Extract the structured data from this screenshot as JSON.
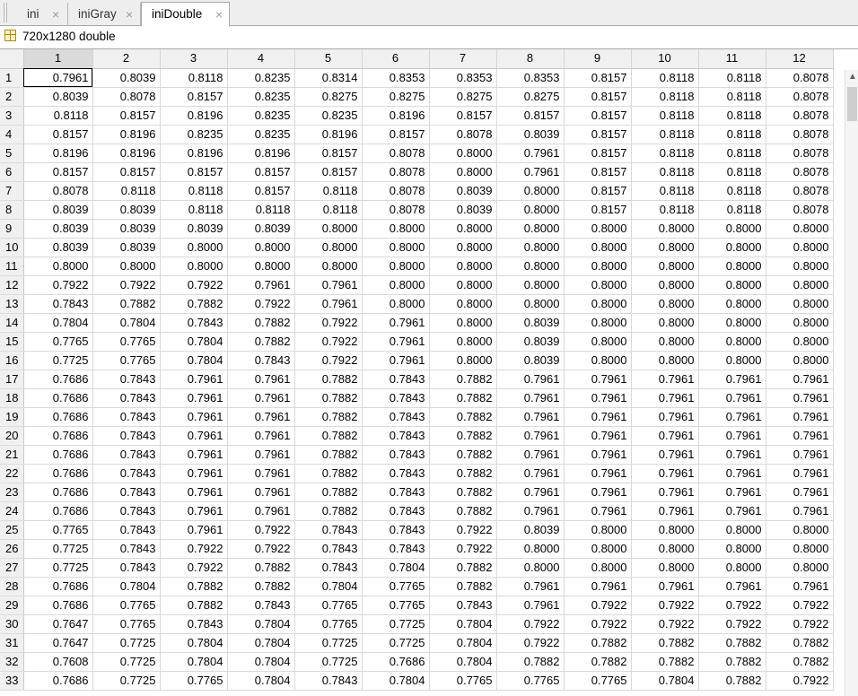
{
  "tabs": [
    {
      "label": "ini",
      "active": false
    },
    {
      "label": "iniGray",
      "active": false
    },
    {
      "label": "iniDouble",
      "active": true
    }
  ],
  "tab_close_glyph": "×",
  "variable_info": "720x1280 double",
  "columns": [
    "1",
    "2",
    "3",
    "4",
    "5",
    "6",
    "7",
    "8",
    "9",
    "10",
    "11",
    "12"
  ],
  "rows": [
    {
      "n": "1",
      "v": [
        "0.7961",
        "0.8039",
        "0.8118",
        "0.8235",
        "0.8314",
        "0.8353",
        "0.8353",
        "0.8353",
        "0.8157",
        "0.8118",
        "0.8118",
        "0.8078"
      ]
    },
    {
      "n": "2",
      "v": [
        "0.8039",
        "0.8078",
        "0.8157",
        "0.8235",
        "0.8275",
        "0.8275",
        "0.8275",
        "0.8275",
        "0.8157",
        "0.8118",
        "0.8118",
        "0.8078"
      ]
    },
    {
      "n": "3",
      "v": [
        "0.8118",
        "0.8157",
        "0.8196",
        "0.8235",
        "0.8235",
        "0.8196",
        "0.8157",
        "0.8157",
        "0.8157",
        "0.8118",
        "0.8118",
        "0.8078"
      ]
    },
    {
      "n": "4",
      "v": [
        "0.8157",
        "0.8196",
        "0.8235",
        "0.8235",
        "0.8196",
        "0.8157",
        "0.8078",
        "0.8039",
        "0.8157",
        "0.8118",
        "0.8118",
        "0.8078"
      ]
    },
    {
      "n": "5",
      "v": [
        "0.8196",
        "0.8196",
        "0.8196",
        "0.8196",
        "0.8157",
        "0.8078",
        "0.8000",
        "0.7961",
        "0.8157",
        "0.8118",
        "0.8118",
        "0.8078"
      ]
    },
    {
      "n": "6",
      "v": [
        "0.8157",
        "0.8157",
        "0.8157",
        "0.8157",
        "0.8157",
        "0.8078",
        "0.8000",
        "0.7961",
        "0.8157",
        "0.8118",
        "0.8118",
        "0.8078"
      ]
    },
    {
      "n": "7",
      "v": [
        "0.8078",
        "0.8118",
        "0.8118",
        "0.8157",
        "0.8118",
        "0.8078",
        "0.8039",
        "0.8000",
        "0.8157",
        "0.8118",
        "0.8118",
        "0.8078"
      ]
    },
    {
      "n": "8",
      "v": [
        "0.8039",
        "0.8039",
        "0.8118",
        "0.8118",
        "0.8118",
        "0.8078",
        "0.8039",
        "0.8000",
        "0.8157",
        "0.8118",
        "0.8118",
        "0.8078"
      ]
    },
    {
      "n": "9",
      "v": [
        "0.8039",
        "0.8039",
        "0.8039",
        "0.8039",
        "0.8000",
        "0.8000",
        "0.8000",
        "0.8000",
        "0.8000",
        "0.8000",
        "0.8000",
        "0.8000"
      ]
    },
    {
      "n": "10",
      "v": [
        "0.8039",
        "0.8039",
        "0.8000",
        "0.8000",
        "0.8000",
        "0.8000",
        "0.8000",
        "0.8000",
        "0.8000",
        "0.8000",
        "0.8000",
        "0.8000"
      ]
    },
    {
      "n": "11",
      "v": [
        "0.8000",
        "0.8000",
        "0.8000",
        "0.8000",
        "0.8000",
        "0.8000",
        "0.8000",
        "0.8000",
        "0.8000",
        "0.8000",
        "0.8000",
        "0.8000"
      ]
    },
    {
      "n": "12",
      "v": [
        "0.7922",
        "0.7922",
        "0.7922",
        "0.7961",
        "0.7961",
        "0.8000",
        "0.8000",
        "0.8000",
        "0.8000",
        "0.8000",
        "0.8000",
        "0.8000"
      ]
    },
    {
      "n": "13",
      "v": [
        "0.7843",
        "0.7882",
        "0.7882",
        "0.7922",
        "0.7961",
        "0.8000",
        "0.8000",
        "0.8000",
        "0.8000",
        "0.8000",
        "0.8000",
        "0.8000"
      ]
    },
    {
      "n": "14",
      "v": [
        "0.7804",
        "0.7804",
        "0.7843",
        "0.7882",
        "0.7922",
        "0.7961",
        "0.8000",
        "0.8039",
        "0.8000",
        "0.8000",
        "0.8000",
        "0.8000"
      ]
    },
    {
      "n": "15",
      "v": [
        "0.7765",
        "0.7765",
        "0.7804",
        "0.7882",
        "0.7922",
        "0.7961",
        "0.8000",
        "0.8039",
        "0.8000",
        "0.8000",
        "0.8000",
        "0.8000"
      ]
    },
    {
      "n": "16",
      "v": [
        "0.7725",
        "0.7765",
        "0.7804",
        "0.7843",
        "0.7922",
        "0.7961",
        "0.8000",
        "0.8039",
        "0.8000",
        "0.8000",
        "0.8000",
        "0.8000"
      ]
    },
    {
      "n": "17",
      "v": [
        "0.7686",
        "0.7843",
        "0.7961",
        "0.7961",
        "0.7882",
        "0.7843",
        "0.7882",
        "0.7961",
        "0.7961",
        "0.7961",
        "0.7961",
        "0.7961"
      ]
    },
    {
      "n": "18",
      "v": [
        "0.7686",
        "0.7843",
        "0.7961",
        "0.7961",
        "0.7882",
        "0.7843",
        "0.7882",
        "0.7961",
        "0.7961",
        "0.7961",
        "0.7961",
        "0.7961"
      ]
    },
    {
      "n": "19",
      "v": [
        "0.7686",
        "0.7843",
        "0.7961",
        "0.7961",
        "0.7882",
        "0.7843",
        "0.7882",
        "0.7961",
        "0.7961",
        "0.7961",
        "0.7961",
        "0.7961"
      ]
    },
    {
      "n": "20",
      "v": [
        "0.7686",
        "0.7843",
        "0.7961",
        "0.7961",
        "0.7882",
        "0.7843",
        "0.7882",
        "0.7961",
        "0.7961",
        "0.7961",
        "0.7961",
        "0.7961"
      ]
    },
    {
      "n": "21",
      "v": [
        "0.7686",
        "0.7843",
        "0.7961",
        "0.7961",
        "0.7882",
        "0.7843",
        "0.7882",
        "0.7961",
        "0.7961",
        "0.7961",
        "0.7961",
        "0.7961"
      ]
    },
    {
      "n": "22",
      "v": [
        "0.7686",
        "0.7843",
        "0.7961",
        "0.7961",
        "0.7882",
        "0.7843",
        "0.7882",
        "0.7961",
        "0.7961",
        "0.7961",
        "0.7961",
        "0.7961"
      ]
    },
    {
      "n": "23",
      "v": [
        "0.7686",
        "0.7843",
        "0.7961",
        "0.7961",
        "0.7882",
        "0.7843",
        "0.7882",
        "0.7961",
        "0.7961",
        "0.7961",
        "0.7961",
        "0.7961"
      ]
    },
    {
      "n": "24",
      "v": [
        "0.7686",
        "0.7843",
        "0.7961",
        "0.7961",
        "0.7882",
        "0.7843",
        "0.7882",
        "0.7961",
        "0.7961",
        "0.7961",
        "0.7961",
        "0.7961"
      ]
    },
    {
      "n": "25",
      "v": [
        "0.7765",
        "0.7843",
        "0.7961",
        "0.7922",
        "0.7843",
        "0.7843",
        "0.7922",
        "0.8039",
        "0.8000",
        "0.8000",
        "0.8000",
        "0.8000"
      ]
    },
    {
      "n": "26",
      "v": [
        "0.7725",
        "0.7843",
        "0.7922",
        "0.7922",
        "0.7843",
        "0.7843",
        "0.7922",
        "0.8000",
        "0.8000",
        "0.8000",
        "0.8000",
        "0.8000"
      ]
    },
    {
      "n": "27",
      "v": [
        "0.7725",
        "0.7843",
        "0.7922",
        "0.7882",
        "0.7843",
        "0.7804",
        "0.7882",
        "0.8000",
        "0.8000",
        "0.8000",
        "0.8000",
        "0.8000"
      ]
    },
    {
      "n": "28",
      "v": [
        "0.7686",
        "0.7804",
        "0.7882",
        "0.7882",
        "0.7804",
        "0.7765",
        "0.7882",
        "0.7961",
        "0.7961",
        "0.7961",
        "0.7961",
        "0.7961"
      ]
    },
    {
      "n": "29",
      "v": [
        "0.7686",
        "0.7765",
        "0.7882",
        "0.7843",
        "0.7765",
        "0.7765",
        "0.7843",
        "0.7961",
        "0.7922",
        "0.7922",
        "0.7922",
        "0.7922"
      ]
    },
    {
      "n": "30",
      "v": [
        "0.7647",
        "0.7765",
        "0.7843",
        "0.7804",
        "0.7765",
        "0.7725",
        "0.7804",
        "0.7922",
        "0.7922",
        "0.7922",
        "0.7922",
        "0.7922"
      ]
    },
    {
      "n": "31",
      "v": [
        "0.7647",
        "0.7725",
        "0.7804",
        "0.7804",
        "0.7725",
        "0.7725",
        "0.7804",
        "0.7922",
        "0.7882",
        "0.7882",
        "0.7882",
        "0.7882"
      ]
    },
    {
      "n": "32",
      "v": [
        "0.7608",
        "0.7725",
        "0.7804",
        "0.7804",
        "0.7725",
        "0.7686",
        "0.7804",
        "0.7882",
        "0.7882",
        "0.7882",
        "0.7882",
        "0.7882"
      ]
    },
    {
      "n": "33",
      "v": [
        "0.7686",
        "0.7725",
        "0.7765",
        "0.7804",
        "0.7843",
        "0.7804",
        "0.7765",
        "0.7765",
        "0.7765",
        "0.7804",
        "0.7882",
        "0.7922"
      ]
    }
  ]
}
